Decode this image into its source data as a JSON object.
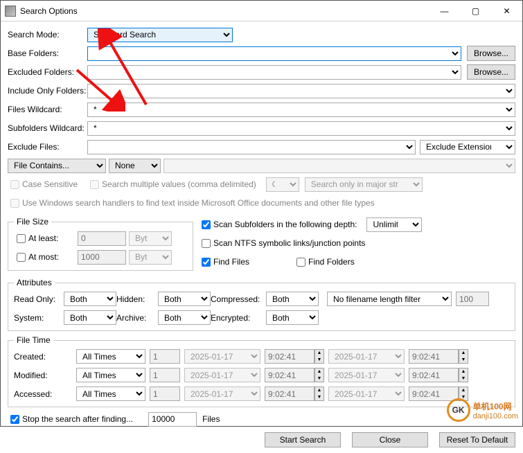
{
  "window": {
    "title": "Search Options"
  },
  "labels": {
    "search_mode": "Search Mode:",
    "base_folders": "Base Folders:",
    "excluded_folders": "Excluded Folders:",
    "include_only": "Include Only Folders:",
    "files_wildcard": "Files Wildcard:",
    "subfolders_wildcard": "Subfolders Wildcard:",
    "exclude_files": "Exclude Files:",
    "case_sensitive": "Case Sensitive",
    "search_multiple": "Search multiple values (comma delimited)",
    "or": "Or",
    "search_major": "Search only in major streams",
    "use_windows": "Use Windows search handlers to find text inside Microsoft Office documents and other file types",
    "at_least": "At least:",
    "at_most": "At most:",
    "scan_sub": "Scan Subfolders in the following depth:",
    "scan_ntfs": "Scan NTFS symbolic links/junction points",
    "find_files": "Find Files",
    "find_folders": "Find Folders",
    "read_only": "Read Only:",
    "hidden": "Hidden:",
    "compressed": "Compressed:",
    "system": "System:",
    "archive": "Archive:",
    "encrypted": "Encrypted:",
    "created": "Created:",
    "modified": "Modified:",
    "accessed": "Accessed:",
    "stop_after": "Stop the search after finding...",
    "files_suffix": "Files"
  },
  "fieldsets": {
    "file_size": "File Size",
    "attributes": "Attributes",
    "file_time": "File Time"
  },
  "values": {
    "search_mode": "Standard Search",
    "base_folders": "",
    "excluded_folders": "",
    "include_only": "",
    "files_wildcard": "*",
    "subfolders_wildcard": "*",
    "exclude_files": "",
    "file_contains": "File Contains...",
    "none": "None",
    "at_least_val": "0",
    "at_most_val": "1000",
    "bytes": "Bytes",
    "unlimited": "Unlimited",
    "both": "Both",
    "no_filter": "No filename length filter",
    "len_val": "100",
    "all_times": "All Times",
    "one": "1",
    "date": "2025-01-17",
    "time": "9:02:41",
    "stop_count": "10000"
  },
  "buttons": {
    "browse": "Browse...",
    "exclude_ext": "Exclude Extensions List",
    "start": "Start Search",
    "close": "Close",
    "reset": "Reset To Default"
  },
  "watermark": {
    "brand": "单机100网",
    "url": "danji100.com",
    "badge": "GK"
  }
}
